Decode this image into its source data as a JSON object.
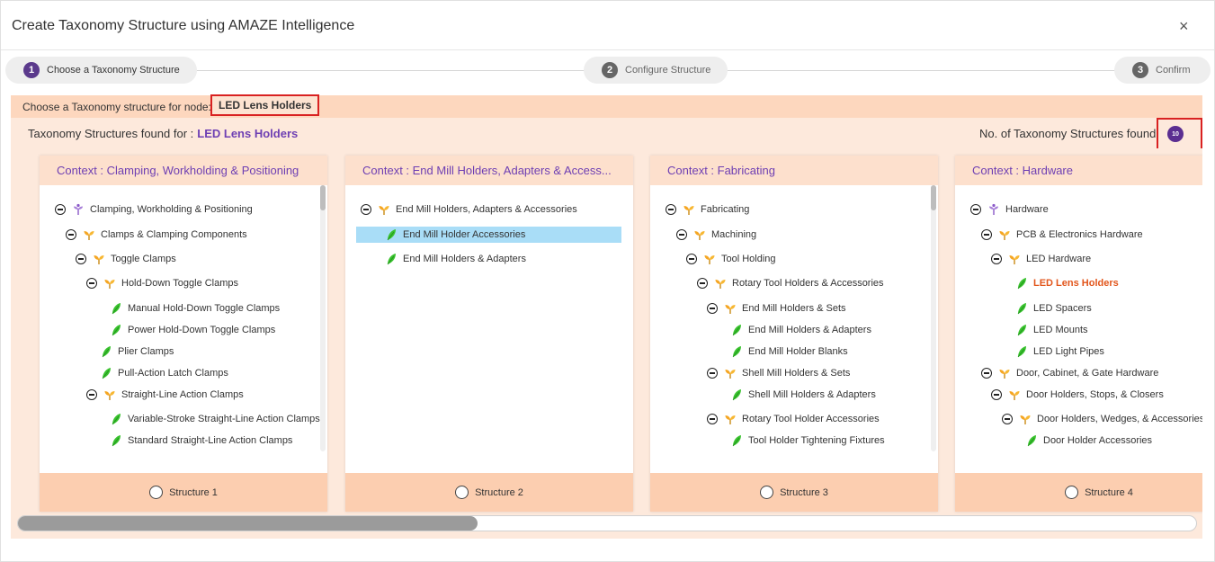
{
  "modal": {
    "title": "Create Taxonomy Structure using AMAZE Intelligence",
    "close_label": "×"
  },
  "stepper": {
    "steps": [
      {
        "num": "1",
        "label": "Choose a Taxonomy Structure",
        "state": "active"
      },
      {
        "num": "2",
        "label": "Configure Structure",
        "state": "inactive"
      },
      {
        "num": "3",
        "label": "Confirm",
        "state": "inactive"
      }
    ]
  },
  "choose": {
    "label": "Choose a Taxonomy structure for node:",
    "node": "LED Lens Holders"
  },
  "found": {
    "label": "Taxonomy Structures found for :",
    "node": "LED Lens Holders",
    "count_label": "No. of Taxonomy Structures found:",
    "count": "10"
  },
  "colors": {
    "accent_purple": "#6e3fb3",
    "badge_purple": "#5b2e91",
    "highlight_red": "#d92121",
    "selected_row": "#a9ddf7",
    "match_orange": "#e2561c"
  },
  "cards": [
    {
      "context": "Context : Clamping, Workholding & Positioning",
      "structure_label": "Structure 1",
      "scroll_position": 0.0,
      "tree": [
        {
          "label": "Clamping, Workholding & Positioning",
          "level": 0,
          "icon": "root-icon",
          "expand": true
        },
        {
          "label": "Clamps & Clamping Components",
          "level": 1,
          "icon": "folder-icon",
          "expand": true
        },
        {
          "label": "Toggle Clamps",
          "level": 2,
          "icon": "folder-icon",
          "expand": true
        },
        {
          "label": "Hold-Down Toggle Clamps",
          "level": 3,
          "icon": "folder-icon",
          "expand": true
        },
        {
          "label": "Manual Hold-Down Toggle Clamps",
          "level": 4,
          "icon": "leaf-icon",
          "expand": false
        },
        {
          "label": "Power Hold-Down Toggle Clamps",
          "level": 4,
          "icon": "leaf-icon",
          "expand": false
        },
        {
          "label": "Plier Clamps",
          "level": 3,
          "icon": "leaf-icon",
          "expand": false
        },
        {
          "label": "Pull-Action Latch Clamps",
          "level": 3,
          "icon": "leaf-icon",
          "expand": false
        },
        {
          "label": "Straight-Line Action Clamps",
          "level": 3,
          "icon": "folder-icon",
          "expand": true
        },
        {
          "label": "Variable-Stroke Straight-Line Action Clamps",
          "level": 4,
          "icon": "leaf-icon",
          "expand": false
        },
        {
          "label": "Standard Straight-Line Action Clamps",
          "level": 4,
          "icon": "leaf-icon",
          "expand": false
        }
      ]
    },
    {
      "context": "Context : End Mill Holders, Adapters & Access...",
      "structure_label": "Structure 2",
      "scroll_position": null,
      "tree": [
        {
          "label": "End Mill Holders, Adapters & Accessories",
          "level": 0,
          "icon": "folder-icon",
          "expand": true
        },
        {
          "label": "End Mill Holder Accessories",
          "level": 1,
          "icon": "leaf-icon",
          "expand": false,
          "selected": true
        },
        {
          "label": "End Mill Holders & Adapters",
          "level": 1,
          "icon": "leaf-icon",
          "expand": false
        }
      ]
    },
    {
      "context": "Context : Fabricating",
      "structure_label": "Structure 3",
      "scroll_position": 0.0,
      "tree": [
        {
          "label": "Fabricating",
          "level": 0,
          "icon": "folder-icon",
          "expand": true
        },
        {
          "label": "Machining",
          "level": 1,
          "icon": "folder-icon",
          "expand": true
        },
        {
          "label": "Tool Holding",
          "level": 2,
          "icon": "folder-icon",
          "expand": true
        },
        {
          "label": "Rotary Tool Holders & Accessories",
          "level": 3,
          "icon": "folder-icon",
          "expand": true
        },
        {
          "label": "End Mill Holders & Sets",
          "level": 4,
          "icon": "folder-icon",
          "expand": true
        },
        {
          "label": "End Mill Holders & Adapters",
          "level": 5,
          "icon": "leaf-icon",
          "expand": false
        },
        {
          "label": "End Mill Holder Blanks",
          "level": 5,
          "icon": "leaf-icon",
          "expand": false
        },
        {
          "label": "Shell Mill Holders & Sets",
          "level": 4,
          "icon": "folder-icon",
          "expand": true
        },
        {
          "label": "Shell Mill Holders & Adapters",
          "level": 5,
          "icon": "leaf-icon",
          "expand": false
        },
        {
          "label": "Rotary Tool Holder Accessories",
          "level": 4,
          "icon": "folder-icon",
          "expand": true
        },
        {
          "label": "Tool Holder Tightening Fixtures",
          "level": 5,
          "icon": "leaf-icon",
          "expand": false
        }
      ]
    },
    {
      "context": "Context : Hardware",
      "structure_label": "Structure 4",
      "scroll_position": null,
      "tree": [
        {
          "label": "Hardware",
          "level": 0,
          "icon": "root-icon",
          "expand": true
        },
        {
          "label": "PCB & Electronics Hardware",
          "level": 1,
          "icon": "folder-icon",
          "expand": true
        },
        {
          "label": "LED Hardware",
          "level": 2,
          "icon": "folder-icon",
          "expand": true
        },
        {
          "label": "LED Lens Holders",
          "level": 3,
          "icon": "leaf-icon",
          "expand": false,
          "match": true
        },
        {
          "label": "LED Spacers",
          "level": 3,
          "icon": "leaf-icon",
          "expand": false
        },
        {
          "label": "LED Mounts",
          "level": 3,
          "icon": "leaf-icon",
          "expand": false
        },
        {
          "label": "LED Light Pipes",
          "level": 3,
          "icon": "leaf-icon",
          "expand": false
        },
        {
          "label": "Door, Cabinet, & Gate Hardware",
          "level": 1,
          "icon": "folder-icon",
          "expand": true
        },
        {
          "label": "Door Holders, Stops, & Closers",
          "level": 2,
          "icon": "folder-icon",
          "expand": true
        },
        {
          "label": "Door Holders, Wedges, & Accessories",
          "level": 3,
          "icon": "folder-icon",
          "expand": true
        },
        {
          "label": "Door Holder Accessories",
          "level": 4,
          "icon": "leaf-icon",
          "expand": false
        }
      ]
    }
  ],
  "horizontal_scroll": {
    "position": 0.0,
    "visible_fraction": 0.39
  }
}
